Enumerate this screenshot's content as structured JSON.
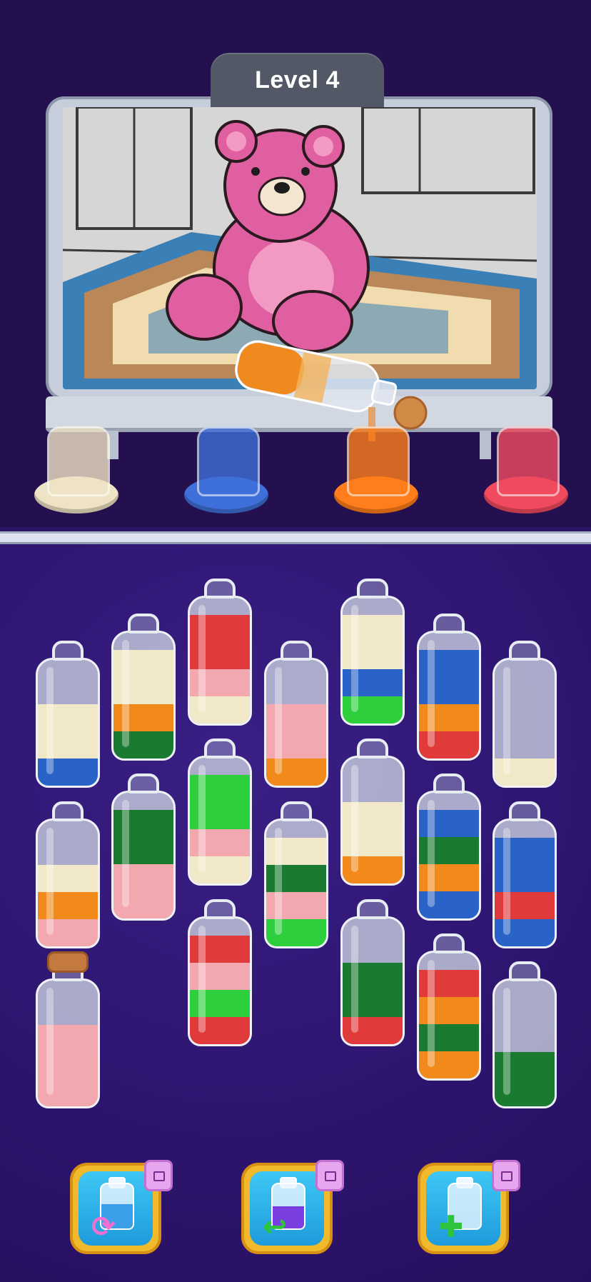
{
  "header": {
    "level_label": "Level 4"
  },
  "picture": {
    "subject": "teddy-bear",
    "colors": {
      "bear": "#e05fa0",
      "bear_muzzle": "#f3e5cf",
      "rug": "#3b7fb7",
      "rug_accent": "#e58a3a",
      "room": "#d4d4d4"
    }
  },
  "pouring_bottle": {
    "fill_color": "#f08a1f",
    "cork_color": "#d08a45"
  },
  "color_jars": [
    {
      "name": "cream",
      "color": "#efe3c5"
    },
    {
      "name": "blue",
      "color": "#3f6fd8"
    },
    {
      "name": "orange",
      "color": "#ff7d1a"
    },
    {
      "name": "red",
      "color": "#ef4a5e"
    }
  ],
  "sand_colors": {
    "red": "#e03a3a",
    "pink": "#f3a8b0",
    "cream": "#f1e8c8",
    "orange": "#f28a1b",
    "green": "#1a7a2f",
    "lime": "#2ecf3c",
    "blue": "#2a63c8"
  },
  "bottles": [
    {
      "layers": [
        "blue",
        "cream",
        "cream"
      ]
    },
    {
      "layers": [
        "green",
        "orange",
        "cream",
        "cream"
      ]
    },
    {
      "layers": [
        "cream",
        "pink",
        "red",
        "red"
      ]
    },
    {
      "layers": [
        "orange",
        "pink",
        "pink"
      ]
    },
    {
      "layers": [
        "lime",
        "blue",
        "cream",
        "cream"
      ]
    },
    {
      "layers": [
        "red",
        "orange",
        "blue",
        "blue"
      ]
    },
    {
      "layers": [
        "cream"
      ]
    },
    {
      "layers": [
        "pink",
        "orange",
        "cream"
      ]
    },
    {
      "layers": [
        "pink",
        "pink",
        "green",
        "green"
      ]
    },
    {
      "layers": [
        "cream",
        "pink",
        "lime",
        "lime"
      ]
    },
    {
      "layers": [
        "lime",
        "pink",
        "green",
        "cream"
      ]
    },
    {
      "layers": [
        "orange",
        "cream",
        "cream"
      ]
    },
    {
      "layers": [
        "blue",
        "orange",
        "green",
        "blue"
      ]
    },
    {
      "layers": [
        "blue",
        "red",
        "blue",
        "blue"
      ]
    },
    {
      "layers": [
        "pink",
        "pink",
        "pink"
      ],
      "corked": true
    },
    {
      "layers": [
        "red",
        "lime",
        "pink",
        "red"
      ]
    },
    {
      "layers": [
        "red",
        "green",
        "green"
      ]
    },
    {
      "layers": [
        "orange",
        "green",
        "orange",
        "red"
      ]
    },
    {
      "layers": [
        "green",
        "green"
      ]
    }
  ],
  "tools": [
    {
      "name": "shuffle",
      "icon": "shuffle-icon",
      "symbol": "⟳",
      "ad": true
    },
    {
      "name": "undo",
      "icon": "undo-icon",
      "symbol": "↩",
      "ad": true
    },
    {
      "name": "add-bottle",
      "icon": "add-bottle-icon",
      "symbol": "✚",
      "ad": true
    }
  ]
}
